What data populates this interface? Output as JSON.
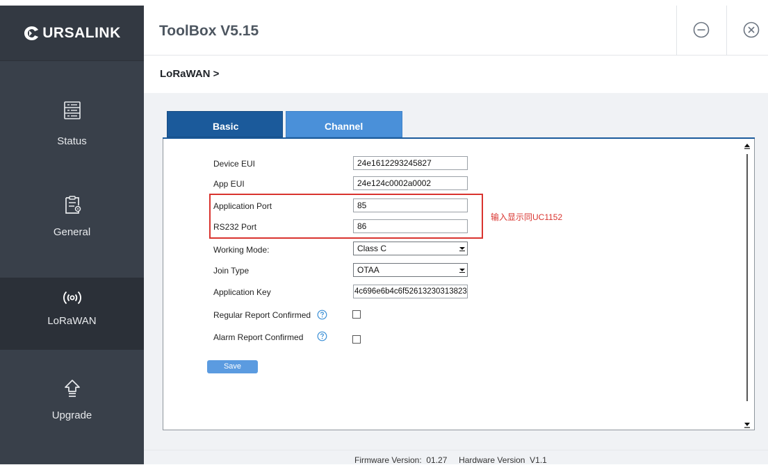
{
  "brand": {
    "logo_text": "URSALINK"
  },
  "header": {
    "title": "ToolBox V5.15",
    "minimize_icon": "minus-circle-icon",
    "close_icon": "close-circle-icon"
  },
  "sidebar": {
    "items": [
      {
        "label": "Status",
        "icon": "status-list-icon"
      },
      {
        "label": "General",
        "icon": "document-gear-icon"
      },
      {
        "label": "LoRaWAN",
        "icon": "radio-waves-icon",
        "active": true
      },
      {
        "label": "Upgrade",
        "icon": "upgrade-arrow-icon"
      }
    ]
  },
  "breadcrumb": "LoRaWAN >",
  "tabs": [
    {
      "label": "Basic",
      "active": true
    },
    {
      "label": "Channel",
      "active": false
    }
  ],
  "form": {
    "device_eui": {
      "label": "Device EUI",
      "value": "24e1612293245827"
    },
    "app_eui": {
      "label": "App EUI",
      "value": "24e124c0002a0002"
    },
    "application_port": {
      "label": "Application Port",
      "value": "85"
    },
    "rs232_port": {
      "label": "RS232 Port",
      "value": "86"
    },
    "working_mode": {
      "label": "Working Mode:",
      "value": "Class C"
    },
    "join_type": {
      "label": "Join Type",
      "value": "OTAA"
    },
    "application_key": {
      "label": "Application Key",
      "value": "4c696e6b4c6f52613230313823"
    },
    "regular_report_confirmed": {
      "label": "Regular Report Confirmed",
      "checked": false
    },
    "alarm_report_confirmed": {
      "label": "Alarm Report Confirmed",
      "checked": false
    },
    "save_label": "Save"
  },
  "annotation": "输入显示同UC1152",
  "footer": {
    "firmware_label": "Firmware Version:",
    "firmware_value": "01.27",
    "hardware_label": "Hardware Version",
    "hardware_value": "V1.1"
  },
  "colors": {
    "sidebar": "#39404a",
    "tab_active": "#1b5a9b",
    "tab_inactive": "#4a90d9",
    "annotation_red": "#d9332e",
    "save_button": "#5b9be0"
  }
}
